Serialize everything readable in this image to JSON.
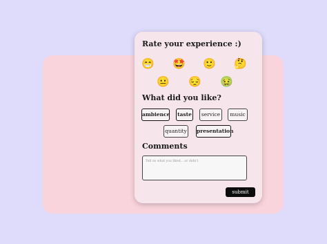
{
  "card": {
    "title": "Rate your experience :)",
    "emojis": [
      "😁",
      "🤩",
      "🙂",
      "🤔",
      "😐",
      "😔",
      "🤢"
    ]
  },
  "likes": {
    "title": "What did you like?",
    "options": [
      "ambience",
      "taste",
      "service",
      "music",
      "quantity",
      "presentation"
    ],
    "selected": [
      "ambience",
      "taste",
      "presentation"
    ]
  },
  "comments": {
    "title": "Comments",
    "placeholder": "Tell us what you liked....or didn't"
  },
  "submit_label": "submit",
  "colors": {
    "background": "#dedbfb",
    "panel": "#f9d4dc",
    "card": "#f6e5ea",
    "button": "#0c0c0c"
  }
}
